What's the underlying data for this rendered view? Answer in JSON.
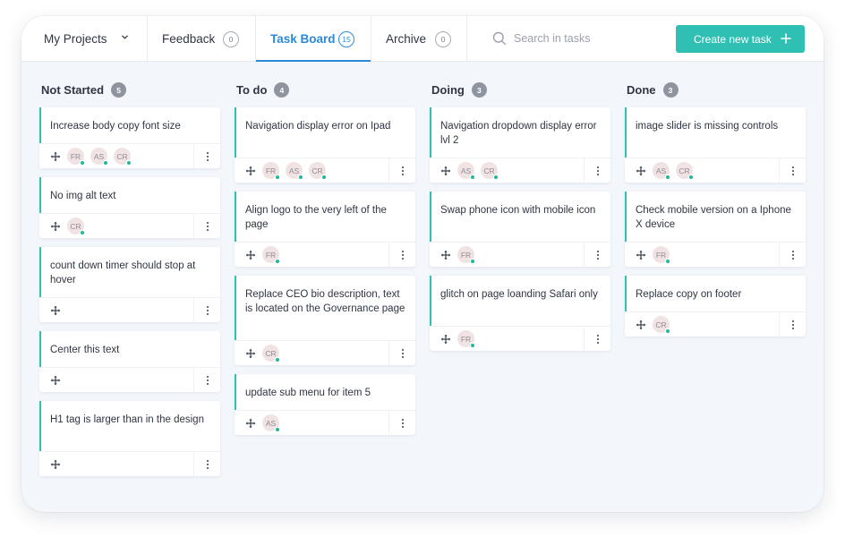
{
  "header": {
    "project_selector": "My Projects",
    "tabs": [
      {
        "label": "Feedback",
        "count": "0"
      },
      {
        "label": "Task Board",
        "count": "15"
      },
      {
        "label": "Archive",
        "count": "0"
      }
    ],
    "search_placeholder": "Search in tasks",
    "create_button": "Create new task"
  },
  "colors": {
    "accent": "#2fc0b3",
    "active_tab": "#2b8ad8",
    "status_dot": "#1fb89a"
  },
  "icons": {
    "move": "move-arrows-icon",
    "menu": "vertical-dots-icon",
    "search": "search-icon",
    "dropdown": "chevron-down-icon",
    "add": "plus-icon"
  },
  "columns": [
    {
      "name": "Not Started",
      "count": "5",
      "cards": [
        {
          "title": "Increase body copy font size",
          "assignees": [
            "FR",
            "AS",
            "CR"
          ]
        },
        {
          "title": "No img alt text",
          "assignees": [
            "CR"
          ]
        },
        {
          "title": "count down timer should stop at hover",
          "assignees": []
        },
        {
          "title": "Center this text",
          "assignees": []
        },
        {
          "title": "H1 tag is larger than in the design",
          "assignees": []
        }
      ]
    },
    {
      "name": "To do",
      "count": "4",
      "cards": [
        {
          "title": "Navigation display error on Ipad",
          "assignees": [
            "FR",
            "AS",
            "CR"
          ]
        },
        {
          "title": "Align logo to the very left of the page",
          "assignees": [
            "FR"
          ]
        },
        {
          "title": "Replace CEO bio description, text is located on the Governance page",
          "assignees": [
            "CR"
          ]
        },
        {
          "title": "update sub menu for item 5",
          "assignees": [
            "AS"
          ]
        }
      ]
    },
    {
      "name": "Doing",
      "count": "3",
      "cards": [
        {
          "title": "Navigation dropdown display error lvl 2",
          "assignees": [
            "AS",
            "CR"
          ]
        },
        {
          "title": "Swap phone icon with mobile icon",
          "assignees": [
            "FR"
          ]
        },
        {
          "title": "glitch on page loanding Safari only",
          "assignees": [
            "FR"
          ]
        }
      ]
    },
    {
      "name": "Done",
      "count": "3",
      "cards": [
        {
          "title": "image slider is missing controls",
          "assignees": [
            "AS",
            "CR"
          ]
        },
        {
          "title": "Check mobile version on a Iphone X device",
          "assignees": [
            "FR"
          ]
        },
        {
          "title": "Replace copy on footer",
          "assignees": [
            "CR"
          ]
        }
      ]
    }
  ]
}
